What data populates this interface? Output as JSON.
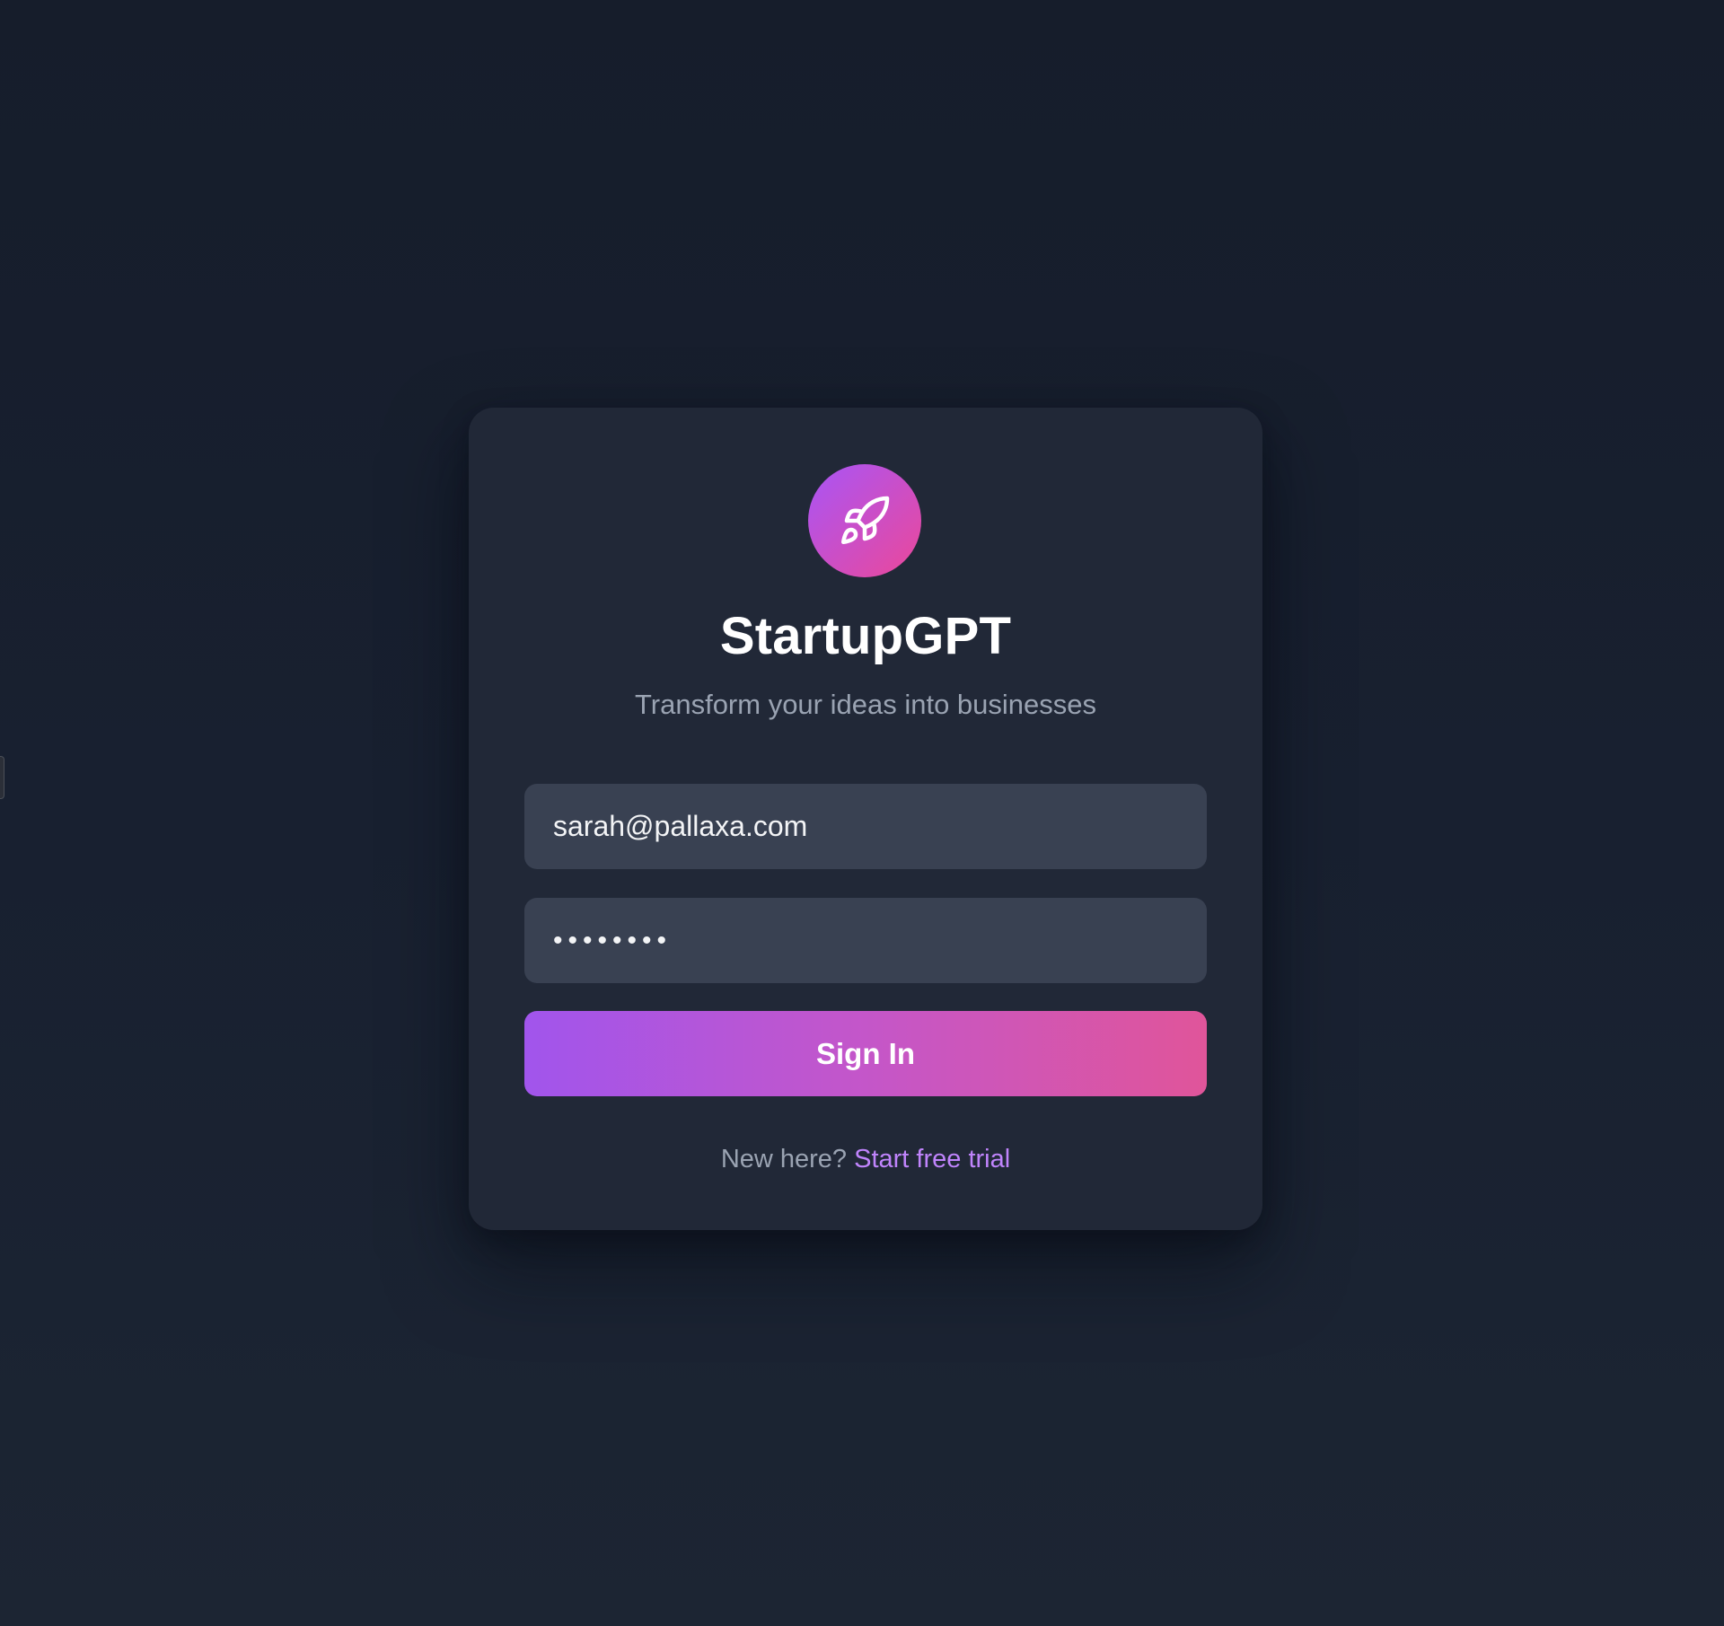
{
  "app": {
    "title": "StartupGPT",
    "tagline": "Transform your ideas into businesses",
    "logo_icon": "rocket-icon"
  },
  "form": {
    "email_value": "sarah@pallaxa.com",
    "password_value": "••••••••",
    "sign_in_label": "Sign In"
  },
  "footer": {
    "prompt": "New here?",
    "link_label": "Start free trial"
  },
  "colors": {
    "background": "#161d2b",
    "card": "#212837",
    "field": "#394152",
    "accent_start": "#a855f7",
    "accent_end": "#ec4899",
    "link": "#c084fc"
  }
}
